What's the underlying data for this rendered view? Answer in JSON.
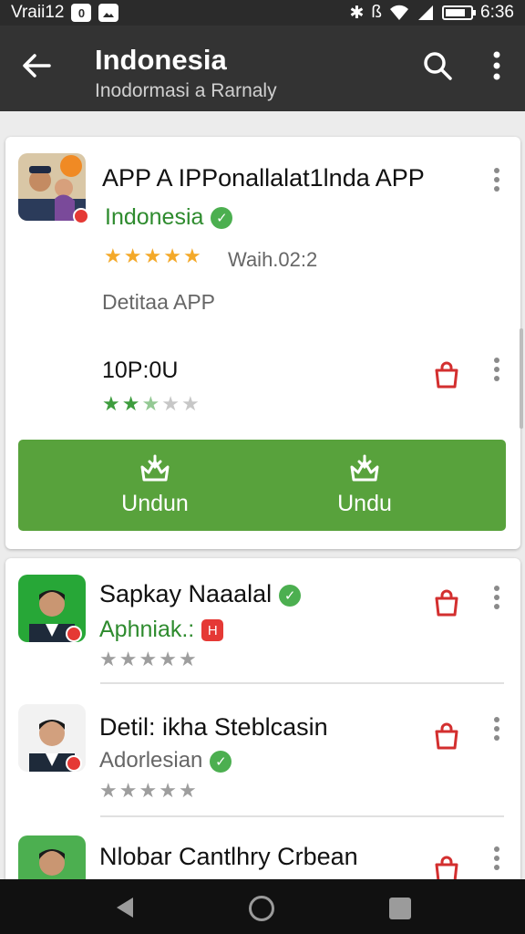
{
  "status_bar": {
    "left_text": "Vraii12",
    "badge_text": "0",
    "time": "6:36",
    "battery_level": 0.8
  },
  "app_bar": {
    "title": "Indonesia",
    "subtitle": "Inodormasi a Rarnaly",
    "icons": [
      "back-arrow-icon",
      "search-icon",
      "more-vert-icon"
    ]
  },
  "featured": {
    "title": "APP A IPPonallalat1lnda APP",
    "developer": "Indonesia",
    "rating_stars": 5,
    "rating_label": "Waih.02:2",
    "description": "Detitaa APP",
    "price": "10P:0U",
    "sub_rating_stars": 2.5,
    "buttons": [
      {
        "label": "Undun"
      },
      {
        "label": "Undu"
      }
    ]
  },
  "list": [
    {
      "title": "Sapkay Naaalal",
      "subtitle": "Aphniak.:",
      "subtitle_verified": false,
      "title_verified": true,
      "rating_stars": 0
    },
    {
      "title": "Detil: ikha Steblcasin",
      "subtitle": "Adorlesian",
      "subtitle_verified": true,
      "title_verified": false,
      "rating_stars": 0
    },
    {
      "title": "Nlobar Cantlhry Crbean",
      "subtitle": "",
      "subtitle_verified": false,
      "title_verified": false,
      "rating_stars": 0
    }
  ],
  "colors": {
    "appbar": "#333333",
    "accent_green": "#58a23c",
    "developer_green": "#2e8b2e",
    "bag_red": "#d32f2f",
    "star_gold": "#f4a929"
  }
}
